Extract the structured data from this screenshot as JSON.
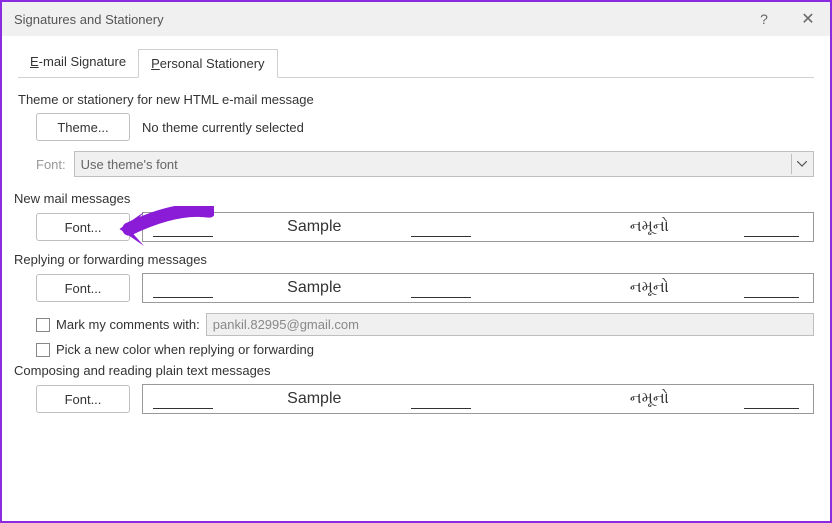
{
  "window": {
    "title": "Signatures and Stationery"
  },
  "tabs": {
    "email_sig": "E-mail Signature",
    "personal": "Personal Stationery"
  },
  "section1": {
    "heading": "Theme or stationery for new HTML e-mail message",
    "theme_btn": "Theme...",
    "no_theme": "No theme currently selected",
    "font_lbl": "Font:",
    "font_sel": "Use theme's font"
  },
  "section2": {
    "heading": "New mail messages",
    "font_btn": "Font...",
    "sample": "Sample",
    "sample2": "નમૂનો"
  },
  "section3": {
    "heading": "Replying or forwarding messages",
    "font_btn": "Font...",
    "sample": "Sample",
    "sample2": "નમૂનો",
    "mark_lbl": "Mark my comments with:",
    "mark_val": "pankil.82995@gmail.com",
    "color_lbl": "Pick a new color when replying or forwarding"
  },
  "section4": {
    "heading": "Composing and reading plain text messages",
    "font_btn": "Font...",
    "sample": "Sample",
    "sample2": "નમૂનો"
  }
}
